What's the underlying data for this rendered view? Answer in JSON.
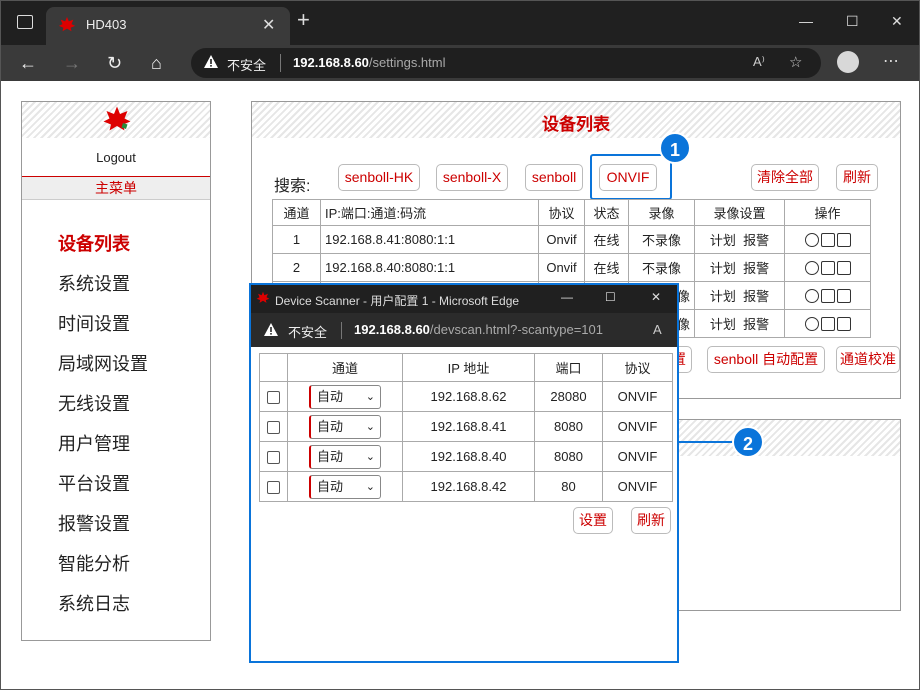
{
  "browser": {
    "tab_title": "HD403",
    "new_tab": "+",
    "not_secure": "不安全",
    "url_host": "192.168.8.60",
    "url_path": "/settings.html",
    "read_aloud": "A⁾"
  },
  "sidebar": {
    "logout": "Logout",
    "menu_header": "主菜单",
    "items": [
      {
        "label": "设备列表",
        "active": true
      },
      {
        "label": "系统设置"
      },
      {
        "label": "时间设置"
      },
      {
        "label": "局域网设置"
      },
      {
        "label": "无线设置"
      },
      {
        "label": "用户管理"
      },
      {
        "label": "平台设置"
      },
      {
        "label": "报警设置"
      },
      {
        "label": "智能分析"
      },
      {
        "label": "系统日志"
      }
    ]
  },
  "device_panel": {
    "title": "设备列表",
    "search_label": "搜索:",
    "search_buttons": [
      "senboll-HK",
      "senboll-X",
      "senboll",
      "ONVIF"
    ],
    "clear_all": "清除全部",
    "refresh": "刷新",
    "columns": [
      "通道",
      "IP:端口:通道:码流",
      "协议",
      "状态",
      "录像",
      "录像设置",
      "操作"
    ],
    "rows": [
      {
        "ch": "1",
        "addr": "192.168.8.41:8080:1:1",
        "proto": "Onvif",
        "status": "在线",
        "rec": "不录像",
        "plan": "计划",
        "alarm": "报警"
      },
      {
        "ch": "2",
        "addr": "192.168.8.40:8080:1:1",
        "proto": "Onvif",
        "status": "在线",
        "rec": "不录像",
        "plan": "计划",
        "alarm": "报警"
      },
      {
        "ch": "",
        "addr": "",
        "proto": "",
        "status": "",
        "rec": "像",
        "plan": "计划",
        "alarm": "报警"
      },
      {
        "ch": "",
        "addr": "",
        "proto": "",
        "status": "",
        "rec": "像",
        "plan": "计划",
        "alarm": "报警"
      }
    ],
    "partial_button": "置",
    "auto_config": "senboll 自动配置",
    "channel_calibrate": "通道校准"
  },
  "callouts": {
    "one": "1",
    "two": "2"
  },
  "popup": {
    "title": "Device Scanner - 用户配置 1 - Microsoft Edge",
    "not_secure": "不安全",
    "url_host": "192.168.8.60",
    "url_path": "/devscan.html?-scantype=101",
    "columns": [
      "通道",
      "IP 地址",
      "端口",
      "协议"
    ],
    "rows": [
      {
        "channel": "自动",
        "ip": "192.168.8.62",
        "port": "28080",
        "proto": "ONVIF"
      },
      {
        "channel": "自动",
        "ip": "192.168.8.41",
        "port": "8080",
        "proto": "ONVIF"
      },
      {
        "channel": "自动",
        "ip": "192.168.8.40",
        "port": "8080",
        "proto": "ONVIF"
      },
      {
        "channel": "自动",
        "ip": "192.168.8.42",
        "port": "80",
        "proto": "ONVIF"
      }
    ],
    "set_button": "设置",
    "refresh_button": "刷新"
  },
  "colors": {
    "accent": "#c00000",
    "focus": "#0a74da"
  }
}
